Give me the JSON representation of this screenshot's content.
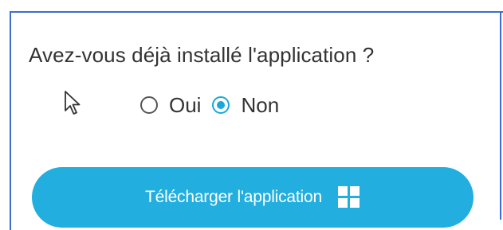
{
  "question": "Avez-vous déjà installé l'application ?",
  "radio": {
    "options": [
      {
        "label": "Oui",
        "selected": false
      },
      {
        "label": "Non",
        "selected": true
      }
    ]
  },
  "download_button": {
    "label": "Télécharger l'application",
    "icon": "windows-icon"
  },
  "colors": {
    "frame": "#3a6fd0",
    "accent": "#1aa7d9",
    "button_bg": "#22aede",
    "text": "#333333"
  },
  "cursor": "arrow-cursor-icon"
}
